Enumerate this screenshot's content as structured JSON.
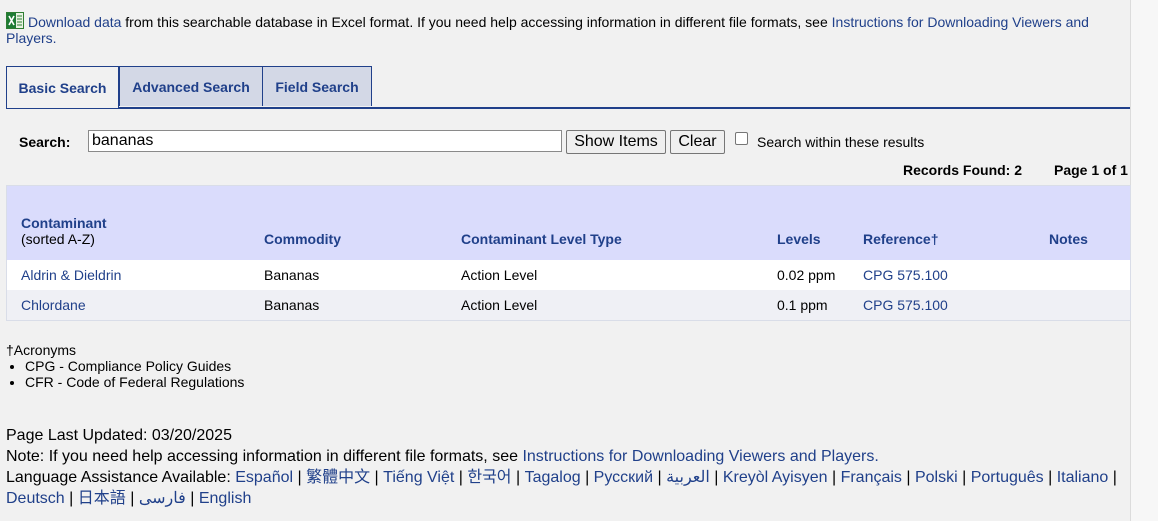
{
  "intro": {
    "download_link": "Download data",
    "text": " from this searchable database in Excel format. If you need help accessing information in different file formats, see ",
    "instructions_link": "Instructions for Downloading Viewers and Players."
  },
  "tabs": [
    {
      "label": "Basic Search",
      "active": true
    },
    {
      "label": "Advanced Search",
      "active": false
    },
    {
      "label": "Field Search",
      "active": false
    }
  ],
  "search": {
    "label": "Search:",
    "value": "bananas",
    "show_button": "Show Items",
    "clear_button": "Clear",
    "within_label": "Search within these results",
    "within_checked": false
  },
  "results": {
    "records_found": "Records Found: 2",
    "page": "Page 1 of 1"
  },
  "table": {
    "headers": {
      "contaminant": "Contaminant",
      "contaminant_sub": "(sorted A-Z)",
      "commodity": "Commodity",
      "level_type": "Contaminant Level Type",
      "levels": "Levels",
      "reference": "Reference†",
      "notes": "Notes"
    },
    "rows": [
      {
        "contaminant": "Aldrin & Dieldrin",
        "commodity": "Bananas",
        "level_type": "Action Level",
        "levels": "0.02 ppm",
        "reference": "CPG 575.100",
        "notes": ""
      },
      {
        "contaminant": "Chlordane",
        "commodity": "Bananas",
        "level_type": "Action Level",
        "levels": "0.1 ppm",
        "reference": "CPG 575.100",
        "notes": ""
      }
    ]
  },
  "acronyms": {
    "title": "†Acronyms",
    "items": [
      "CPG - Compliance Policy Guides",
      "CFR - Code of Federal Regulations"
    ]
  },
  "footer": {
    "updated": "Page Last Updated: 03/20/2025",
    "note_text": "Note: If you need help accessing information in different file formats, see ",
    "note_link": "Instructions for Downloading Viewers and Players.",
    "language_label": "Language Assistance Available: ",
    "languages": [
      "Español",
      "繁體中文",
      "Tiếng Việt",
      "한국어",
      "Tagalog",
      "Русский",
      "العربية",
      "Kreyòl Ayisyen",
      "Français",
      "Polski",
      "Português",
      "Italiano",
      "Deutsch",
      "日本語",
      "فارسی",
      "English"
    ]
  },
  "colors": {
    "link": "#20408a",
    "header_bg": "#dadcfc",
    "tab_bg": "#d3d8e6"
  },
  "icons": {
    "excel": "excel-icon"
  }
}
